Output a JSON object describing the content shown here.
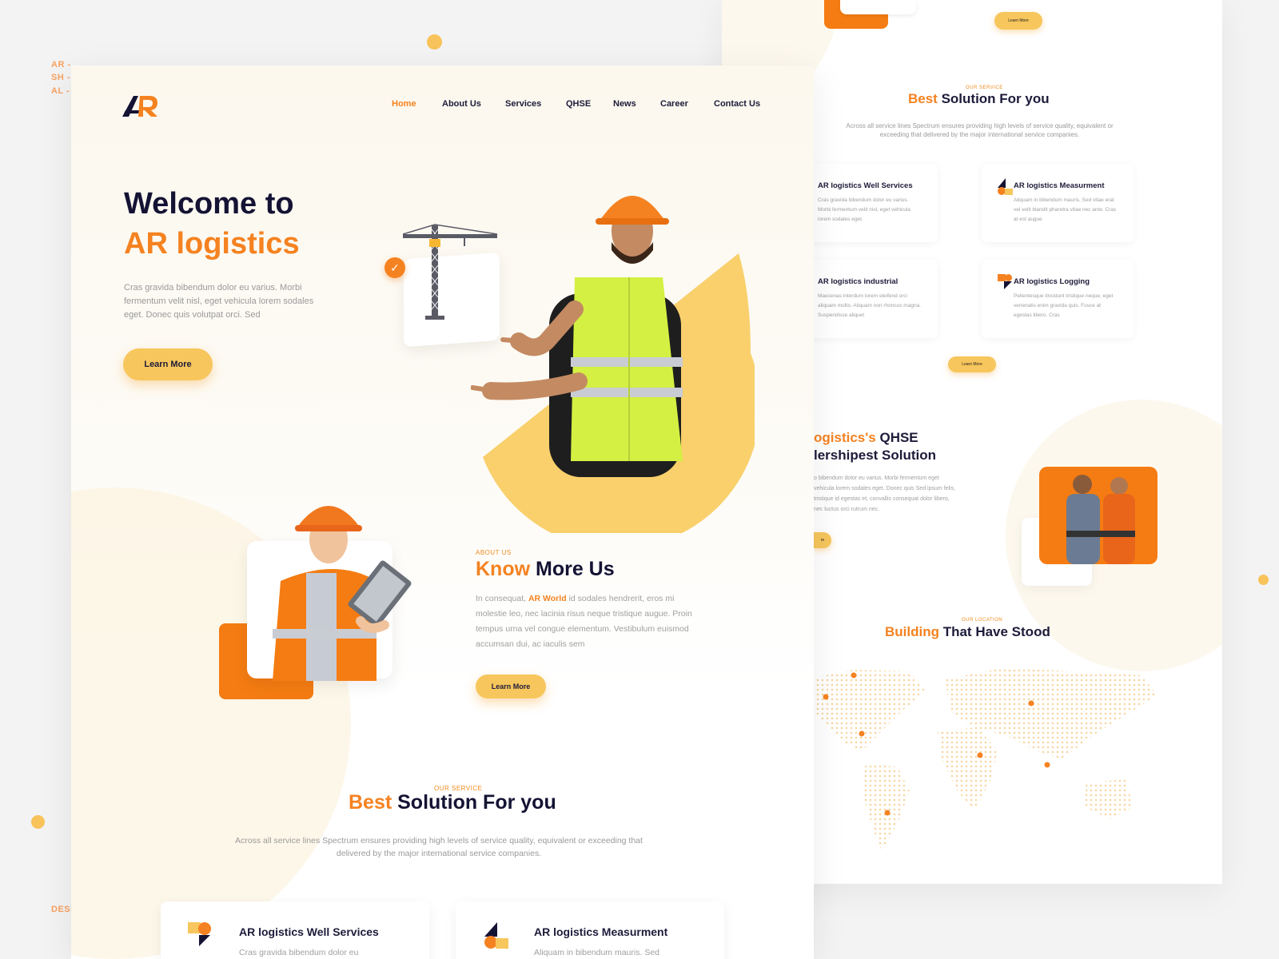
{
  "side_labels": [
    "AR -",
    "SH -",
    "AL -"
  ],
  "design_label": "DESIGN -",
  "brand": {
    "logo_text": "AR"
  },
  "nav": {
    "items": [
      {
        "label": "Home",
        "active": true
      },
      {
        "label": "About Us"
      },
      {
        "label": "Services"
      },
      {
        "label": "QHSE"
      },
      {
        "label": "News"
      },
      {
        "label": "Career"
      },
      {
        "label": "Contact Us"
      }
    ]
  },
  "hero": {
    "title_line1": "Welcome to",
    "title_line2": "AR logistics",
    "description": "Cras gravida bibendum dolor eu varius. Morbi fermentum velit nisl, eget vehicula lorem sodales eget. Donec quis volutpat orci. Sed",
    "button": "Learn More"
  },
  "about": {
    "eyebrow": "ABOUT US",
    "title_accent": "Know",
    "title_rest": " More Us",
    "desc_prefix": "In consequat, ",
    "desc_highlight": "AR World",
    "desc_suffix": " id sodales hendrerit, eros mi molestie leo, nec lacinia risus neque tristique augue. Proin tempus urna vel congue elementum. Vestibulum euismod accumsan dui, ac iaculis sem",
    "button": "Learn More"
  },
  "services": {
    "eyebrow": "OUR SERVICE",
    "title_accent": "Best",
    "title_rest": " Solution For you",
    "description": "Across all service lines Spectrum ensures providing high levels of service quality, equivalent or exceeding that delivered by the major international service companies.",
    "cards": [
      {
        "title": "AR logistics Well Services",
        "desc": "Cras gravida bibendum dolor eu"
      },
      {
        "title": "AR logistics Measurment",
        "desc": "Aliquam in bibendum mauris. Sed"
      }
    ]
  },
  "back": {
    "top_button": "Learn More",
    "services": {
      "eyebrow": "OUR SERVICE",
      "title_accent": "Best",
      "title_rest": " Solution For you",
      "description": "Across all service lines Spectrum ensures providing high levels of service quality, equivalent or exceeding that delivered by the major international service companies.",
      "cards": [
        {
          "title": "AR logistics Well Services",
          "desc": "Cras gravida bibendum dolor eu varius. Morbi fermentum velit nisl, eget vehicula lorem sodales eget."
        },
        {
          "title": "AR logistics Measurment",
          "desc": "Aliquam in bibendum mauris. Sed vitae erat vel velit blandit pharetra vitae nec ante. Cras at est augue"
        },
        {
          "title": "AR logistics industrial",
          "desc": "Maecenas interdum lorem eleifend orci aliquam mollis. Aliquam non rhoncus magna. Suspendisse aliquet"
        },
        {
          "title": "AR logistics Logging",
          "desc": "Pellentesque tincidunt tristique neque, eget venenatis enim gravida quis. Fusce at egestas libero. Cras"
        }
      ],
      "button": "Learn More"
    },
    "qhse": {
      "title_line1_accent": "ogistics's",
      "title_line1_rest": " QHSE",
      "title_line2": "lershipest Solution",
      "description": "o bibendum dolor eu varius. Morbi fermentum eget vehicula lorem sodales eget. Donec quis Sed ipsum felis, tristique id egestas et, convallis consequat dolor libero, nec luctus orci rutrum nec.",
      "button_fragment": "re"
    },
    "location": {
      "eyebrow": "OUR LOCATION",
      "title_accent": "Building",
      "title_rest": " That Have Stood"
    }
  },
  "colors": {
    "accent": "#f58220",
    "yellow": "#f7c65c",
    "navy": "#141334"
  }
}
